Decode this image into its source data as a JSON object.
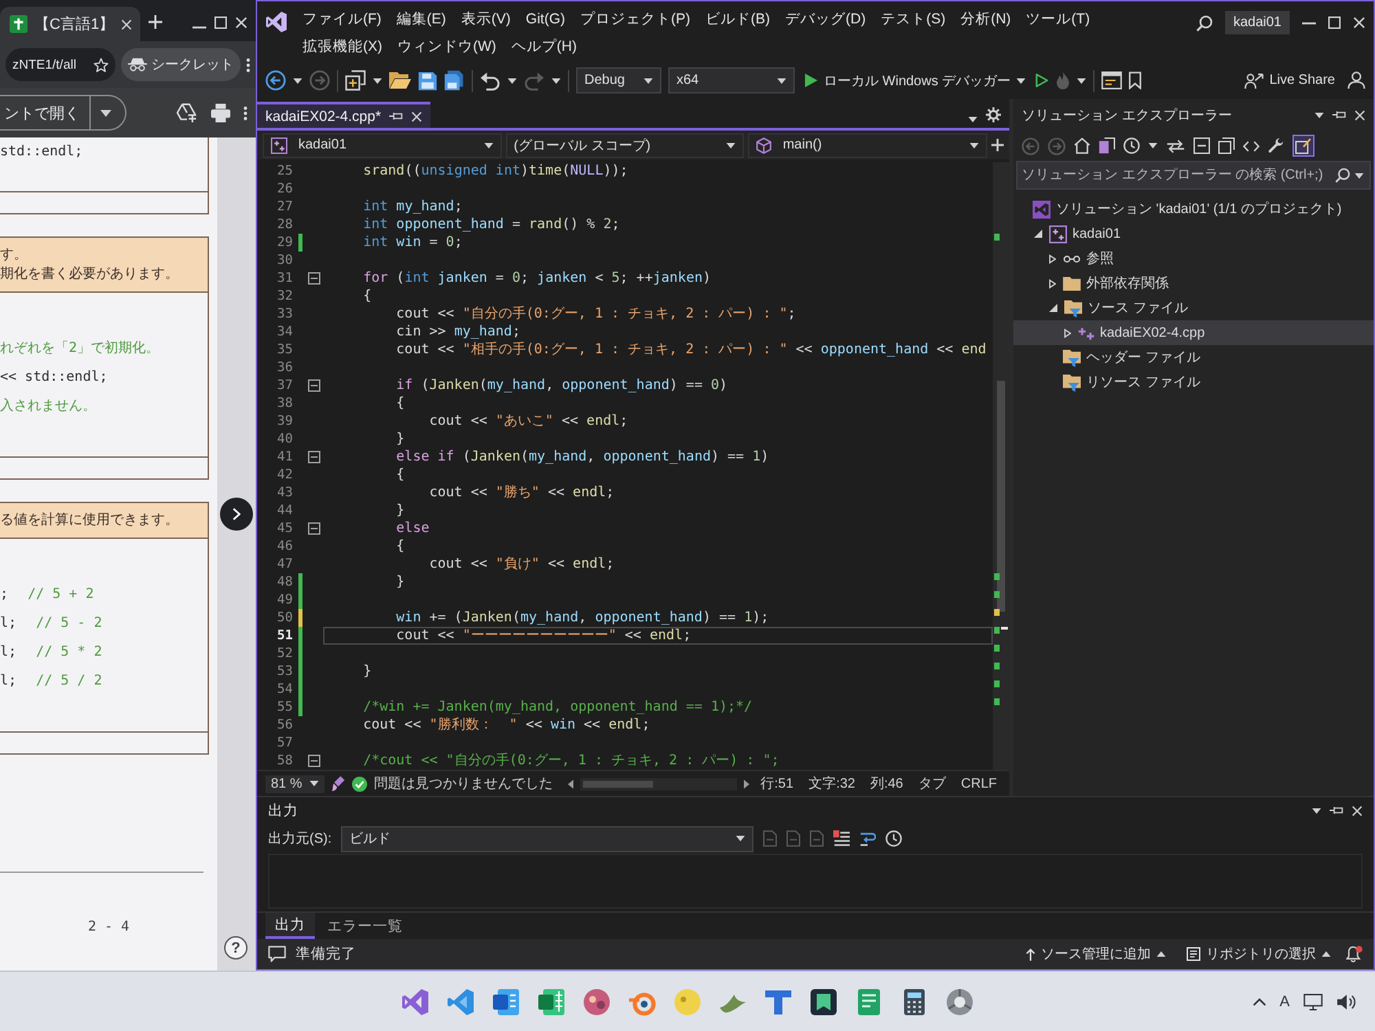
{
  "browser": {
    "tab_title": "【C言語1】",
    "address": "zNTE1/t/all",
    "incognito": "シークレット",
    "open_button": "ントで開く",
    "boxes": [
      {
        "body": [
          {
            "code": "std::endl;"
          }
        ]
      },
      {
        "header": [
          "す。",
          "期化を書く必要があります。"
        ],
        "body": [
          {
            "comment": "れぞれを「2」で初期化。"
          },
          {
            "code": "<< std::endl;"
          },
          {
            "comment": "入されません。"
          }
        ]
      },
      {
        "header": [
          "る値を計算に使用できます。"
        ],
        "body": [
          {
            "code": ";",
            "comment": "// 5 + 2"
          },
          {
            "code": "l;",
            "comment": "// 5 - 2"
          },
          {
            "code": "l;",
            "comment": "// 5 * 2"
          },
          {
            "code": "l;",
            "comment": "// 5 / 2"
          }
        ]
      }
    ],
    "page_number": "2 - 4",
    "help": "?"
  },
  "vs": {
    "menu": [
      "ファイル(F)",
      "編集(E)",
      "表示(V)",
      "Git(G)",
      "プロジェクト(P)",
      "ビルド(B)",
      "デバッグ(D)",
      "テスト(S)",
      "分析(N)",
      "ツール(T)",
      "拡張機能(X)",
      "ウィンドウ(W)",
      "ヘルプ(H)"
    ],
    "solution_name": "kadai01",
    "configuration": "Debug",
    "platform": "x64",
    "run_target": "ローカル Windows デバッガー",
    "live_share": "Live Share",
    "document_tabs": [
      {
        "title": "kadaiEX02-4.cpp*",
        "selected": true
      }
    ],
    "navigation": {
      "project": "kadai01",
      "scope": "(グローバル スコープ)",
      "member": "main()"
    },
    "editor": {
      "lines": [
        {
          "number": "25",
          "selected": false,
          "tokens": [
            {
              "kind": "function",
              "text": "    srand"
            },
            {
              "kind": "plain",
              "text": "(("
            },
            {
              "kind": "keyword",
              "text": "unsigned int"
            },
            {
              "kind": "plain",
              "text": ")"
            },
            {
              "kind": "function",
              "text": "time"
            },
            {
              "kind": "plain",
              "text": "("
            },
            {
              "kind": "macro",
              "text": "NULL"
            },
            {
              "kind": "plain",
              "text": "));"
            }
          ]
        },
        {
          "number": "26",
          "selected": false
        },
        {
          "number": "27",
          "selected": false,
          "tokens": [
            {
              "kind": "keyword",
              "text": "    int "
            },
            {
              "kind": "variable",
              "text": "my_hand"
            },
            {
              "kind": "plain",
              "text": ";"
            }
          ]
        },
        {
          "number": "28",
          "selected": false,
          "tokens": [
            {
              "kind": "keyword",
              "text": "    int "
            },
            {
              "kind": "variable",
              "text": "opponent_hand"
            },
            {
              "kind": "plain",
              "text": " = "
            },
            {
              "kind": "function",
              "text": "rand"
            },
            {
              "kind": "plain",
              "text": "() % "
            },
            {
              "kind": "number",
              "text": "2"
            },
            {
              "kind": "plain",
              "text": ";"
            }
          ]
        },
        {
          "number": "29",
          "selected": false,
          "color": "#3fb950",
          "tokens": [
            {
              "kind": "keyword",
              "text": "    int "
            },
            {
              "kind": "variable",
              "text": "win"
            },
            {
              "kind": "plain",
              "text": " = "
            },
            {
              "kind": "number",
              "text": "0"
            },
            {
              "kind": "plain",
              "text": ";"
            }
          ]
        },
        {
          "number": "30",
          "selected": false
        },
        {
          "number": "31",
          "selected": false,
          "expanded": true,
          "tokens": [
            {
              "kind": "control",
              "text": "    for"
            },
            {
              "kind": "plain",
              "text": " ("
            },
            {
              "kind": "keyword",
              "text": "int "
            },
            {
              "kind": "variable",
              "text": "janken"
            },
            {
              "kind": "plain",
              "text": " = "
            },
            {
              "kind": "number",
              "text": "0"
            },
            {
              "kind": "plain",
              "text": "; "
            },
            {
              "kind": "variable",
              "text": "janken"
            },
            {
              "kind": "plain",
              "text": " < "
            },
            {
              "kind": "number",
              "text": "5"
            },
            {
              "kind": "plain",
              "text": "; ++"
            },
            {
              "kind": "variable",
              "text": "janken"
            },
            {
              "kind": "plain",
              "text": ")"
            }
          ]
        },
        {
          "number": "32",
          "selected": false,
          "tokens": [
            {
              "kind": "plain",
              "text": "    {"
            }
          ]
        },
        {
          "number": "33",
          "selected": false,
          "tokens": [
            {
              "kind": "plain",
              "text": "        cout << "
            },
            {
              "kind": "string",
              "text": "\"自分の手(0:グー, 1 : チョキ, 2 : パー) : \""
            },
            {
              "kind": "plain",
              "text": ";"
            }
          ]
        },
        {
          "number": "34",
          "selected": false,
          "tokens": [
            {
              "kind": "plain",
              "text": "        cin >> "
            },
            {
              "kind": "variable",
              "text": "my_hand"
            },
            {
              "kind": "plain",
              "text": ";"
            }
          ]
        },
        {
          "number": "35",
          "selected": false,
          "tokens": [
            {
              "kind": "plain",
              "text": "        cout << "
            },
            {
              "kind": "string",
              "text": "\"相手の手(0:グー, 1 : チョキ, 2 : パー) : \""
            },
            {
              "kind": "plain",
              "text": " << "
            },
            {
              "kind": "variable",
              "text": "opponent_hand"
            },
            {
              "kind": "plain",
              "text": " << "
            },
            {
              "kind": "function",
              "text": "end"
            }
          ]
        },
        {
          "number": "36",
          "selected": false
        },
        {
          "number": "37",
          "selected": false,
          "expanded": true,
          "tokens": [
            {
              "kind": "control",
              "text": "        if"
            },
            {
              "kind": "plain",
              "text": " ("
            },
            {
              "kind": "function",
              "text": "Janken"
            },
            {
              "kind": "plain",
              "text": "("
            },
            {
              "kind": "variable",
              "text": "my_hand"
            },
            {
              "kind": "plain",
              "text": ", "
            },
            {
              "kind": "variable",
              "text": "opponent_hand"
            },
            {
              "kind": "plain",
              "text": ") == "
            },
            {
              "kind": "number",
              "text": "0"
            },
            {
              "kind": "plain",
              "text": ")"
            }
          ]
        },
        {
          "number": "38",
          "selected": false,
          "tokens": [
            {
              "kind": "plain",
              "text": "        {"
            }
          ]
        },
        {
          "number": "39",
          "selected": false,
          "tokens": [
            {
              "kind": "plain",
              "text": "            cout << "
            },
            {
              "kind": "string",
              "text": "\"あいこ\""
            },
            {
              "kind": "plain",
              "text": " << "
            },
            {
              "kind": "function",
              "text": "endl"
            },
            {
              "kind": "plain",
              "text": ";"
            }
          ]
        },
        {
          "number": "40",
          "selected": false,
          "tokens": [
            {
              "kind": "plain",
              "text": "        }"
            }
          ]
        },
        {
          "number": "41",
          "selected": false,
          "expanded": true,
          "tokens": [
            {
              "kind": "control",
              "text": "        else if"
            },
            {
              "kind": "plain",
              "text": " ("
            },
            {
              "kind": "function",
              "text": "Janken"
            },
            {
              "kind": "plain",
              "text": "("
            },
            {
              "kind": "variable",
              "text": "my_hand"
            },
            {
              "kind": "plain",
              "text": ", "
            },
            {
              "kind": "variable",
              "text": "opponent_hand"
            },
            {
              "kind": "plain",
              "text": ") == "
            },
            {
              "kind": "number",
              "text": "1"
            },
            {
              "kind": "plain",
              "text": ")"
            }
          ]
        },
        {
          "number": "42",
          "selected": false,
          "tokens": [
            {
              "kind": "plain",
              "text": "        {"
            }
          ]
        },
        {
          "number": "43",
          "selected": false,
          "tokens": [
            {
              "kind": "plain",
              "text": "            cout << "
            },
            {
              "kind": "string",
              "text": "\"勝ち\""
            },
            {
              "kind": "plain",
              "text": " << "
            },
            {
              "kind": "function",
              "text": "endl"
            },
            {
              "kind": "plain",
              "text": ";"
            }
          ]
        },
        {
          "number": "44",
          "selected": false,
          "tokens": [
            {
              "kind": "plain",
              "text": "        }"
            }
          ]
        },
        {
          "number": "45",
          "selected": false,
          "expanded": true,
          "tokens": [
            {
              "kind": "control",
              "text": "        else"
            }
          ]
        },
        {
          "number": "46",
          "selected": false,
          "tokens": [
            {
              "kind": "plain",
              "text": "        {"
            }
          ]
        },
        {
          "number": "47",
          "selected": false,
          "tokens": [
            {
              "kind": "plain",
              "text": "            cout << "
            },
            {
              "kind": "string",
              "text": "\"負け\""
            },
            {
              "kind": "plain",
              "text": " << "
            },
            {
              "kind": "function",
              "text": "endl"
            },
            {
              "kind": "plain",
              "text": ";"
            }
          ]
        },
        {
          "number": "48",
          "selected": false,
          "color": "#3fb950",
          "tokens": [
            {
              "kind": "plain",
              "text": "        }"
            }
          ]
        },
        {
          "number": "49",
          "selected": false,
          "color": "#3fb950"
        },
        {
          "number": "50",
          "selected": false,
          "color": "#e2c04a",
          "tokens": [
            {
              "kind": "variable",
              "text": "        win"
            },
            {
              "kind": "plain",
              "text": " += ("
            },
            {
              "kind": "function",
              "text": "Janken"
            },
            {
              "kind": "plain",
              "text": "("
            },
            {
              "kind": "variable",
              "text": "my_hand"
            },
            {
              "kind": "plain",
              "text": ", "
            },
            {
              "kind": "variable",
              "text": "opponent_hand"
            },
            {
              "kind": "plain",
              "text": ") == "
            },
            {
              "kind": "number",
              "text": "1"
            },
            {
              "kind": "plain",
              "text": ");"
            }
          ]
        },
        {
          "number": "51",
          "selected": true,
          "color": "#3fb950",
          "tokens": [
            {
              "kind": "plain",
              "text": "        cout << "
            },
            {
              "kind": "string",
              "text": "\"ーーーーーーーーーー\""
            },
            {
              "kind": "plain",
              "text": " << "
            },
            {
              "kind": "function",
              "text": "endl"
            },
            {
              "kind": "plain",
              "text": ";"
            }
          ]
        },
        {
          "number": "52",
          "selected": false,
          "color": "#3fb950"
        },
        {
          "number": "53",
          "selected": false,
          "color": "#3fb950",
          "tokens": [
            {
              "kind": "plain",
              "text": "    }"
            }
          ]
        },
        {
          "number": "54",
          "selected": false,
          "color": "#3fb950"
        },
        {
          "number": "55",
          "selected": false,
          "color": "#3fb950",
          "tokens": [
            {
              "kind": "comment",
              "text": "    /*win += Janken(my_hand, opponent_hand == 1);*/"
            }
          ]
        },
        {
          "number": "56",
          "selected": false,
          "tokens": [
            {
              "kind": "plain",
              "text": "    cout << "
            },
            {
              "kind": "string",
              "text": "\"勝利数：  \""
            },
            {
              "kind": "plain",
              "text": " << "
            },
            {
              "kind": "variable",
              "text": "win"
            },
            {
              "kind": "plain",
              "text": " << "
            },
            {
              "kind": "function",
              "text": "endl"
            },
            {
              "kind": "plain",
              "text": ";"
            }
          ]
        },
        {
          "number": "57",
          "selected": false
        },
        {
          "number": "58",
          "selected": false,
          "expanded": true,
          "tokens": [
            {
              "kind": "comment",
              "text": "    /*cout << \"自分の手(0:グー, 1 : チョキ, 2 : パー) : \";"
            }
          ]
        }
      ]
    },
    "editor_status": {
      "zoom": "81 %",
      "issues": "問題は見つかりませんでした",
      "line": "行:51",
      "character": "文字:32",
      "column": "列:46",
      "indent": "タブ",
      "line_ending": "CRLF"
    },
    "solution_explorer": {
      "title": "ソリューション エクスプローラー",
      "search_placeholder": "ソリューション エクスプローラー の検索 (Ctrl+;)",
      "preview_on": true,
      "tree": [
        {
          "label": "ソリューション 'kadai01' (1/1 のプロジェクト)",
          "kind": "solution",
          "selected": false,
          "children": [
            {
              "label": "kadai01",
              "kind": "project",
              "expanded": true,
              "selected": false,
              "children": [
                {
                  "label": "参照",
                  "kind": "references",
                  "expanded": false,
                  "selected": false
                },
                {
                  "label": "外部依存関係",
                  "kind": "folder",
                  "expanded": false,
                  "selected": false
                },
                {
                  "label": "ソース ファイル",
                  "kind": "filter",
                  "expanded": true,
                  "selected": false,
                  "children": [
                    {
                      "label": "kadaiEX02-4.cpp",
                      "kind": "cpp",
                      "expanded": false,
                      "selected": true
                    }
                  ]
                },
                {
                  "label": "ヘッダー ファイル",
                  "kind": "filter",
                  "selected": false
                },
                {
                  "label": "リソース ファイル",
                  "kind": "filter",
                  "selected": false
                }
              ]
            }
          ]
        }
      ]
    },
    "output": {
      "title": "出力",
      "source_label": "出力元(S):",
      "source": "ビルド"
    },
    "panel_tabs": [
      {
        "label": "出力",
        "selected": true
      },
      {
        "label": "エラー一覧",
        "selected": false
      }
    ],
    "status_bar": {
      "message": "準備完了",
      "source_control": "ソース管理に追加",
      "repository": "リポジトリの選択"
    }
  },
  "taskbar": {
    "ime": "A"
  }
}
